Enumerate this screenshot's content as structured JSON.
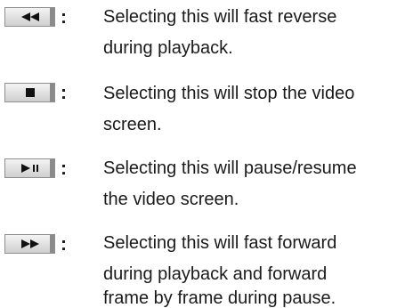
{
  "entries": [
    {
      "icon": "fast-reverse-icon",
      "lines": [
        "Selecting this will fast reverse",
        "during playback."
      ]
    },
    {
      "icon": "stop-icon",
      "lines": [
        "Selecting this will stop the video",
        "screen."
      ]
    },
    {
      "icon": "play-pause-icon",
      "lines": [
        "Selecting this will pause/resume",
        "the video screen."
      ]
    },
    {
      "icon": "fast-forward-icon",
      "lines": [
        "Selecting this will fast forward",
        "during playback and forward",
        "frame by frame during pause."
      ]
    }
  ],
  "separator": ":",
  "colors": {
    "text": "#1a1a1a",
    "icon": "#111111",
    "button_border": "#8e8e8e"
  }
}
